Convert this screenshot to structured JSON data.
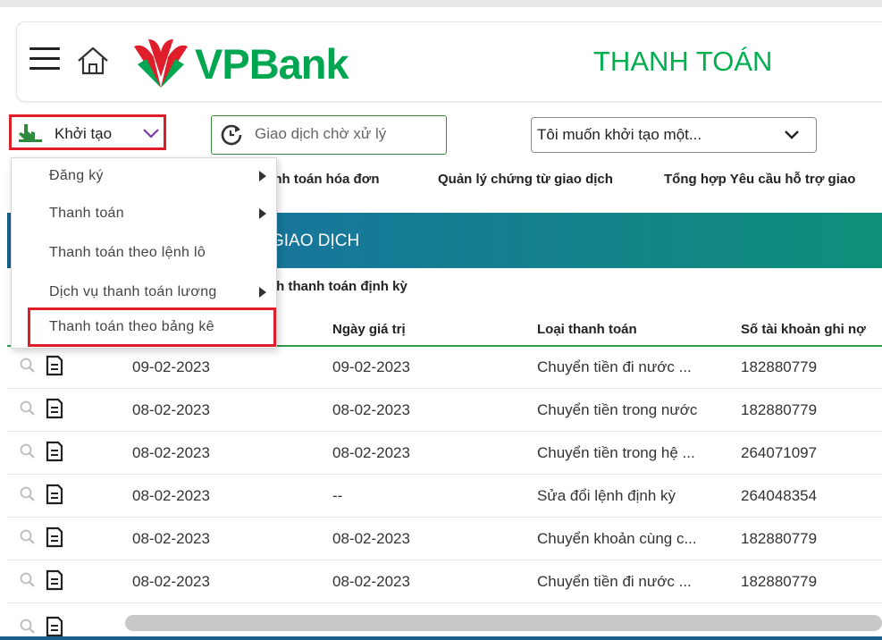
{
  "header": {
    "brand": "VPBank",
    "title": "THANH TOÁN"
  },
  "toolbar": {
    "create_label": "Khởi tạo",
    "pending_label": "Giao dịch chờ xử lý",
    "i_want_value": "Tôi muốn khởi tạo một..."
  },
  "subnav": {
    "items": [
      "anh toán hóa đơn",
      "Quản lý chứng từ giao dịch",
      "Tổng hợp Yêu cầu hỗ trợ giao"
    ]
  },
  "banner": {
    "title": "GIAO DỊCH"
  },
  "periodic_link": "nh thanh toán định kỳ",
  "dropdown": {
    "items": [
      {
        "label": "Đăng ký",
        "has_submenu": true
      },
      {
        "label": "Thanh toán",
        "has_submenu": true
      },
      {
        "label": "Thanh toán theo lệnh lô",
        "has_submenu": false
      },
      {
        "label": "Dịch vụ thanh toán lương",
        "has_submenu": true
      },
      {
        "label": "Thanh toán theo bảng kê",
        "has_submenu": false
      }
    ]
  },
  "table": {
    "columns": [
      "Ngày giá trị",
      "Loại thanh toán",
      "Số tài khoản ghi nợ"
    ],
    "rows": [
      {
        "date": "09-02-2023",
        "value_date": "09-02-2023",
        "type": "Chuyển tiền đi nước ...",
        "account": "182880779"
      },
      {
        "date": "08-02-2023",
        "value_date": "08-02-2023",
        "type": "Chuyển tiền trong nước",
        "account": "182880779"
      },
      {
        "date": "08-02-2023",
        "value_date": "08-02-2023",
        "type": "Chuyển tiền trong hệ ...",
        "account": "264071097"
      },
      {
        "date": "08-02-2023",
        "value_date": "--",
        "type": "Sửa đổi lệnh định kỳ",
        "account": "264048354"
      },
      {
        "date": "08-02-2023",
        "value_date": "08-02-2023",
        "type": "Chuyển khoản cùng c...",
        "account": "182880779"
      },
      {
        "date": "08-02-2023",
        "value_date": "08-02-2023",
        "type": "Chuyển tiền đi nước ...",
        "account": "182880779"
      }
    ]
  },
  "colors": {
    "brand_green": "#00a650",
    "highlight_red": "#e01e2b",
    "banner_blue": "#155f8a"
  },
  "icons": [
    "menu-icon",
    "home-icon",
    "vpbank-logo",
    "hand-pointer-icon",
    "chevron-down-icon",
    "clock-refresh-icon",
    "zoom-icon",
    "document-icon",
    "submenu-arrow-icon"
  ]
}
